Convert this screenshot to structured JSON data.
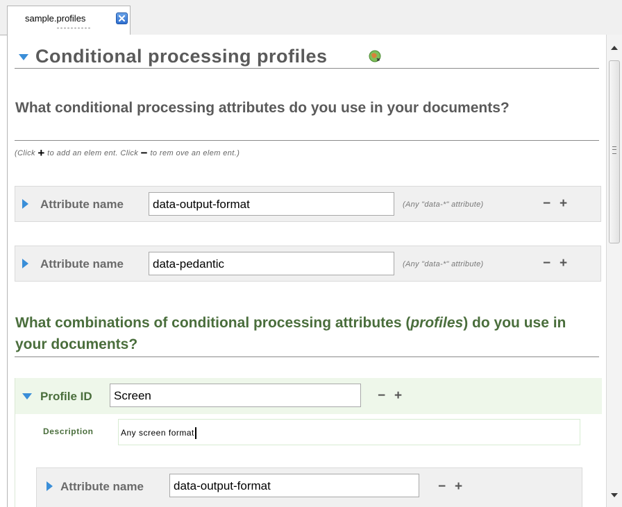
{
  "tab": {
    "label": "sample.profiles"
  },
  "section": {
    "title": "Conditional processing profiles",
    "question_attributes": "What conditional processing attributes do you use in your documents?",
    "hint": {
      "click1": "(Click ",
      "plus": "+",
      "mid": " to add an elem ent. Click ",
      "minus": "−",
      "end": " to rem ove an elem ent.)"
    },
    "attributes": [
      {
        "label": "Attribute name",
        "value": "data-output-format",
        "note": "(Any \"data-*\" attribute)"
      },
      {
        "label": "Attribute name",
        "value": "data-pedantic",
        "note": "(Any \"data-*\" attribute)"
      }
    ],
    "question_profiles_pre": "What combinations of conditional processing attributes (",
    "question_profiles_em": "profiles",
    "question_profiles_post": ") do you use in your documents?",
    "profile": {
      "label": "Profile ID",
      "value": "Screen",
      "description_label": "Description",
      "description_value": "Any screen format",
      "attribute": {
        "label": "Attribute name",
        "value": "data-output-format"
      }
    }
  },
  "controls": {
    "minus": "−",
    "plus": "+"
  },
  "icons": {
    "tab_close": "close-icon",
    "expanded": "triangle-down-icon",
    "collapsed": "triangle-right-icon",
    "refresh": "refresh-globe-icon"
  },
  "colors": {
    "accent_blue": "#3a8ed8",
    "heading_gray": "#5a5a5a",
    "heading_green": "#4a6e3c",
    "profile_bg": "#eef7ea"
  }
}
